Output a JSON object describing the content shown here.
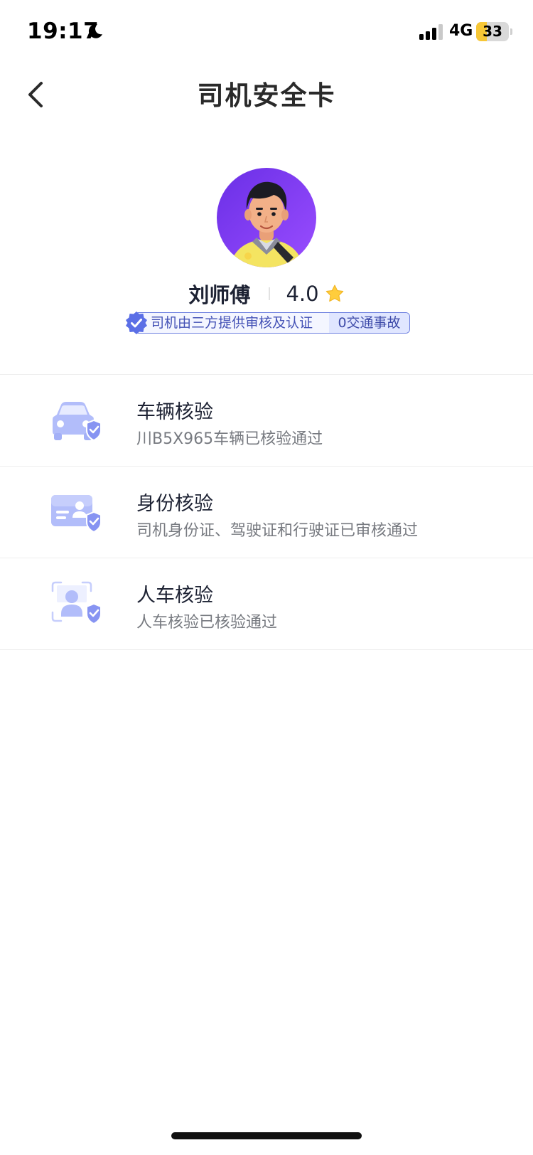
{
  "status_bar": {
    "time": "19:17",
    "network": "4G",
    "battery_level": "33",
    "battery_fraction": 0.33
  },
  "header": {
    "title": "司机安全卡",
    "back_icon": "chevron-left-icon"
  },
  "driver": {
    "name": "刘师傅",
    "rating": "4.0",
    "rating_icon": "star-icon",
    "verification_text": "司机由三方提供审核及认证",
    "accident_badge": "0交通事故"
  },
  "checks": [
    {
      "title": "车辆核验",
      "description": "川B5X965车辆已核验通过",
      "icon": "car-shield-icon"
    },
    {
      "title": "身份核验",
      "description": "司机身份证、驾驶证和行驶证已审核通过",
      "icon": "id-card-shield-icon"
    },
    {
      "title": "人车核验",
      "description": "人车核验已核验通过",
      "icon": "face-scan-shield-icon"
    }
  ],
  "colors": {
    "accent": "#6d7fe0",
    "badge_text": "#4452b6",
    "icon_blue": "#8f9cf2",
    "avatar_bg": "#7a3cf0",
    "battery_yellow": "#f7c736"
  }
}
